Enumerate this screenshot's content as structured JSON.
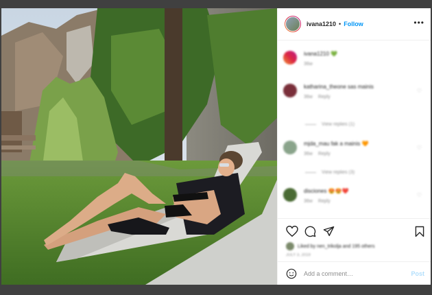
{
  "header": {
    "username": "ivana1210",
    "separator": "•",
    "follow_label": "Follow",
    "more_label": "•••"
  },
  "caption": {
    "username": "ivana1210",
    "emoji": "💚",
    "time": "36w"
  },
  "comments": [
    {
      "text": "katharina_theone sas mainis",
      "time": "36w",
      "reply": "Reply",
      "view_replies": "View replies (1)"
    },
    {
      "text": "mjda_mau fak a mainis 🧡",
      "time": "36w",
      "reply": "Reply",
      "view_replies": "View replies (3)"
    },
    {
      "text": "disciones 😍😍❤️",
      "time": "36w",
      "reply": "Reply"
    }
  ],
  "actions": {
    "likes_text": "Liked by nen_trikolja and 195 others",
    "date": "JULY 3, 2019"
  },
  "add_comment": {
    "placeholder": "Add a comment…",
    "post_label": "Post"
  }
}
